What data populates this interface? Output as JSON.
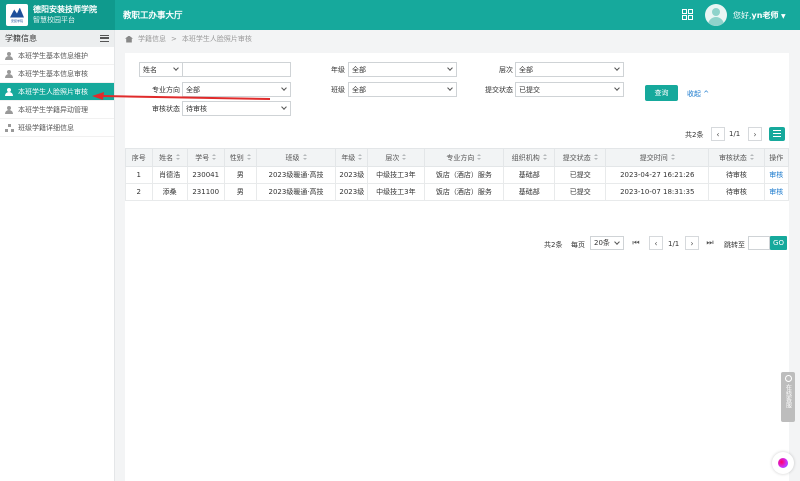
{
  "header": {
    "school_name": "德阳安装技师学院",
    "platform_name": "智慧校园平台",
    "logo_text": "安装学院",
    "app_title": "教职工办事大厅",
    "greeting": "您好,",
    "user_name": "yn老师",
    "grid_icon": "apps-grid-icon",
    "avatar_icon": "user-avatar-icon"
  },
  "sidebar": {
    "title": "学籍信息",
    "items": [
      {
        "label": "本班学生基本信息维护",
        "icon": "user-icon"
      },
      {
        "label": "本班学生基本信息审核",
        "icon": "user-icon"
      },
      {
        "label": "本班学生人脸照片审核",
        "icon": "user-icon"
      },
      {
        "label": "本班学生学籍异动管理",
        "icon": "user-icon"
      },
      {
        "label": "班级学籍详细信息",
        "icon": "org-tree-icon"
      }
    ]
  },
  "breadcrumb": {
    "root": "学籍信息",
    "separator": ">",
    "current": "本班学生人脸照片审核"
  },
  "filters": {
    "name_field": {
      "label": "姓名",
      "value": ""
    },
    "grade": {
      "label": "年级",
      "value": "全部"
    },
    "level": {
      "label": "层次",
      "value": "全部"
    },
    "major": {
      "label": "专业方向",
      "value": "全部"
    },
    "class": {
      "label": "班级",
      "value": "全部"
    },
    "submit_status": {
      "label": "提交状态",
      "value": "已提交"
    },
    "review_status": {
      "label": "审核状态",
      "value": "待审核"
    },
    "query_button": "查询",
    "collapse_link": "收起 ^"
  },
  "pager_top": {
    "total": "共2条",
    "page": "1/1"
  },
  "table": {
    "headers": [
      "序号",
      "姓名",
      "学号",
      "性别",
      "班级",
      "年级",
      "层次",
      "专业方向",
      "组织机构",
      "提交状态",
      "提交时间",
      "审核状态",
      "操作"
    ],
    "rows": [
      [
        "1",
        "肖德浩",
        "230041",
        "男",
        "2023级暖通·高技",
        "2023级",
        "中级技工3年",
        "饭店（酒店）服务",
        "基础部",
        "已提交",
        "2023-04-27 16:21:26",
        "待审核",
        "审核"
      ],
      [
        "2",
        "添桑",
        "231100",
        "男",
        "2023级暖通·高技",
        "2023级",
        "中级技工3年",
        "饭店（酒店）服务",
        "基础部",
        "已提交",
        "2023-10-07 18:31:35",
        "待审核",
        "审核"
      ]
    ]
  },
  "pager_bottom": {
    "total": "共2条",
    "per_page_label": "每页",
    "per_page": "20条",
    "page": "1/1",
    "jump_label": "跳转至",
    "go": "GO"
  },
  "float_tab": {
    "label": "在线客服"
  },
  "colors": {
    "primary": "#16a99c",
    "link": "#1677cc",
    "arrow": "#e02b2b"
  }
}
